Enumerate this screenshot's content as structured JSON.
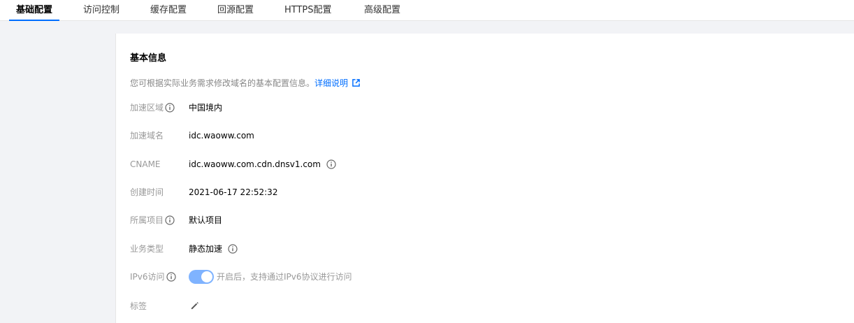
{
  "tabs": [
    {
      "label": "基础配置",
      "active": true
    },
    {
      "label": "访问控制"
    },
    {
      "label": "缓存配置"
    },
    {
      "label": "回源配置"
    },
    {
      "label": "HTTPS配置"
    },
    {
      "label": "高级配置"
    }
  ],
  "section": {
    "title": "基本信息",
    "description": "您可根据实际业务需求修改域名的基本配置信息。",
    "link_label": "详细说明"
  },
  "fields": {
    "region": {
      "label": "加速区域",
      "value": "中国境内"
    },
    "domain": {
      "label": "加速域名",
      "value": "idc.waoww.com"
    },
    "cname": {
      "label": "CNAME",
      "value": "idc.waoww.com.cdn.dnsv1.com"
    },
    "created": {
      "label": "创建时间",
      "value": "2021-06-17 22:52:32"
    },
    "project": {
      "label": "所属项目",
      "value": "默认项目"
    },
    "biz_type": {
      "label": "业务类型",
      "value": "静态加速"
    },
    "ipv6": {
      "label": "IPv6访问",
      "enabled": true,
      "hint": "开启后，支持通过IPv6协议进行访问"
    },
    "tags": {
      "label": "标签"
    }
  },
  "colors": {
    "accent": "#006eff",
    "toggle_on": "#7fb3ff"
  }
}
